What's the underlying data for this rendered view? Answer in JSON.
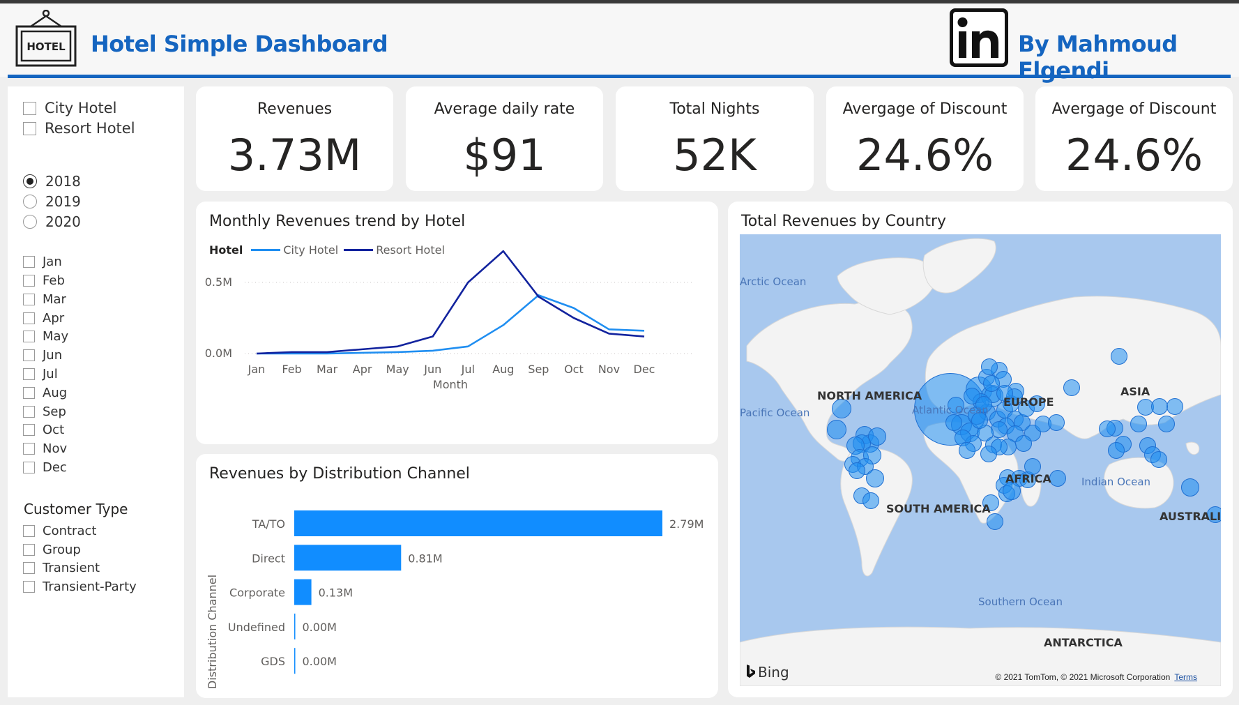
{
  "header": {
    "logo_text": "HOTEL",
    "title": "Hotel Simple Dashboard",
    "author": "By Mahmoud Elgendi",
    "linkedin_icon": "linkedin-icon"
  },
  "colors": {
    "accent": "#1565c0",
    "city_hotel": "#1f8ef1",
    "resort_hotel": "#12239e",
    "bar": "#118dff",
    "bubble": "#1f8ef1"
  },
  "filters": {
    "hotels": [
      "City Hotel",
      "Resort Hotel"
    ],
    "years": [
      {
        "label": "2018",
        "selected": true
      },
      {
        "label": "2019",
        "selected": false
      },
      {
        "label": "2020",
        "selected": false
      }
    ],
    "months": [
      "Jan",
      "Feb",
      "Mar",
      "Apr",
      "May",
      "Jun",
      "Jul",
      "Aug",
      "Sep",
      "Oct",
      "Nov",
      "Dec"
    ],
    "customer_type_title": "Customer Type",
    "customer_types": [
      "Contract",
      "Group",
      "Transient",
      "Transient-Party"
    ]
  },
  "kpis": [
    {
      "label": "Revenues",
      "value": "3.73M"
    },
    {
      "label": "Average daily rate",
      "value": "$91"
    },
    {
      "label": "Total Nights",
      "value": "52K"
    },
    {
      "label": "Avergage of Discount",
      "value": "24.6%"
    },
    {
      "label": "Avergage of Discount",
      "value": "24.6%"
    }
  ],
  "line_chart": {
    "title": "Monthly Revenues trend by Hotel",
    "legend_title": "Hotel"
  },
  "bar_chart": {
    "title": "Revenues by Distribution Channel"
  },
  "map": {
    "title": "Total Revenues by Country",
    "continents": [
      "NORTH AMERICA",
      "SOUTH AMERICA",
      "EUROPE",
      "AFRICA",
      "ASIA",
      "AUSTRALIA",
      "ANTARCTICA"
    ],
    "oceans": [
      "Arctic Ocean",
      "Pacific Ocean",
      "Atlantic Ocean",
      "Indian Ocean",
      "Southern Ocean"
    ],
    "provider": "Bing",
    "copyright": "© 2021 TomTom, © 2021 Microsoft Corporation",
    "terms": "Terms"
  },
  "chart_data": [
    {
      "type": "line",
      "title": "Monthly Revenues trend by Hotel",
      "xlabel": "Month",
      "ylabel": "",
      "x": [
        "Jan",
        "Feb",
        "Mar",
        "Apr",
        "May",
        "Jun",
        "Jul",
        "Aug",
        "Sep",
        "Oct",
        "Nov",
        "Dec"
      ],
      "yticks": [
        "0.0M",
        "0.5M"
      ],
      "ylim": [
        0,
        0.75
      ],
      "legend_position": "top-left",
      "series": [
        {
          "name": "City Hotel",
          "values": [
            0.0,
            0.0,
            0.0,
            0.005,
            0.01,
            0.02,
            0.05,
            0.2,
            0.41,
            0.32,
            0.17,
            0.16
          ]
        },
        {
          "name": "Resort Hotel",
          "values": [
            0.0,
            0.01,
            0.01,
            0.03,
            0.05,
            0.12,
            0.5,
            0.72,
            0.4,
            0.25,
            0.14,
            0.12
          ]
        }
      ]
    },
    {
      "type": "bar",
      "orientation": "horizontal",
      "title": "Revenues by Distribution Channel",
      "ylabel": "Distribution Channel",
      "categories": [
        "TA/TO",
        "Direct",
        "Corporate",
        "Undefined",
        "GDS"
      ],
      "values": [
        2.79,
        0.81,
        0.13,
        0.0,
        0.0
      ],
      "labels": [
        "2.79M",
        "0.81M",
        "0.13M",
        "0.00M",
        "0.00M"
      ]
    }
  ]
}
